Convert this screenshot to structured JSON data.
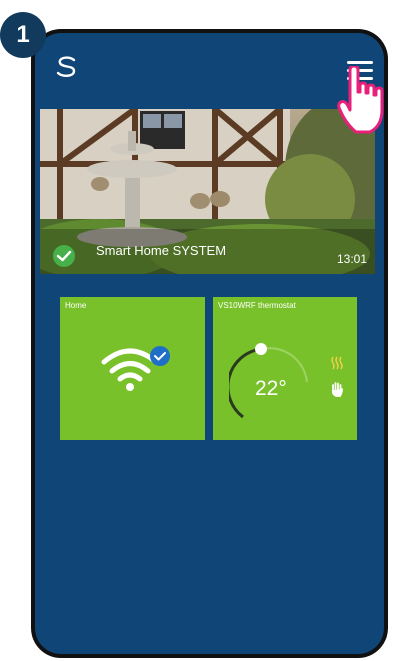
{
  "step": {
    "number": "1"
  },
  "header": {
    "logo_icon": "s-logo-icon",
    "menu_icon": "hamburger-menu-icon"
  },
  "hero": {
    "title": "Smart Home SYSTEM",
    "time": "13:01",
    "status_icon": "check-circle-icon"
  },
  "tiles": [
    {
      "label": "Home",
      "icon": "wifi-check-icon"
    },
    {
      "label": "VS10WRF thermostat",
      "temperature": "22°",
      "icons": [
        "heating-icon",
        "hand-manual-icon"
      ]
    }
  ],
  "colors": {
    "screen_bg": "#0f4577",
    "tile_green": "#78c12a",
    "check_green": "#47b04b",
    "badge_blue": "#1f6ec8",
    "hand_pink": "#e8207a"
  }
}
